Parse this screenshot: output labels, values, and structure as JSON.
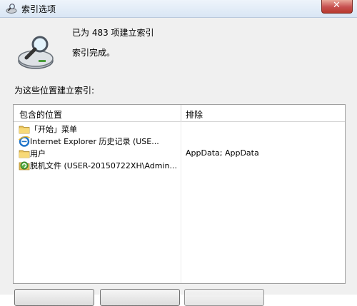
{
  "window": {
    "title": "索引选项",
    "close_glyph": "✕"
  },
  "summary": {
    "count_text": "已为 483 项建立索引",
    "status_text": "索引完成。"
  },
  "locations_label": "为这些位置建立索引:",
  "table": {
    "headers": [
      "包含的位置",
      "排除"
    ],
    "rows": [
      {
        "icon": "folder-icon",
        "location": "「开始」菜单",
        "exclude": ""
      },
      {
        "icon": "internet-explorer-icon",
        "location": "Internet Explorer 历史记录 (USE...",
        "exclude": ""
      },
      {
        "icon": "folder-icon",
        "location": "用户",
        "exclude": "AppData; AppData"
      },
      {
        "icon": "offline-files-icon",
        "location": "脱机文件 (USER-20150722XH\\Admin...",
        "exclude": ""
      }
    ]
  },
  "colors": {
    "title_gradient_top": "#eef4fb",
    "close_red": "#c75050",
    "client_bg": "#f0f0f0"
  }
}
